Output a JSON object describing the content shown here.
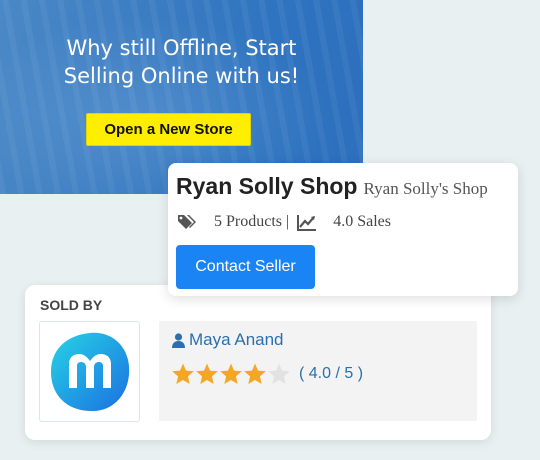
{
  "banner": {
    "headline_line1": "Why still Offline, Start",
    "headline_line2": "Selling Online with us!",
    "cta_label": "Open a New Store",
    "cta_color": "#ffee00"
  },
  "shop": {
    "name": "Ryan Solly Shop",
    "subtitle": "Ryan Solly's Shop",
    "products": "5 Products",
    "separator": "|",
    "sales": "4.0 Sales",
    "contact_label": "Contact Seller",
    "icons": [
      "tags-icon",
      "line-chart-icon"
    ],
    "accent_color": "#1b84f5"
  },
  "sold_by": {
    "label": "SOLD BY",
    "logo_icon": "m-logo-icon",
    "seller_icon": "user-icon",
    "seller_name": "Maya Anand",
    "rating": 4.0,
    "rating_max": 5,
    "rating_text": "( 4.0 / 5 )",
    "star_color": "#f5a623",
    "link_color": "#2a6fb0"
  }
}
